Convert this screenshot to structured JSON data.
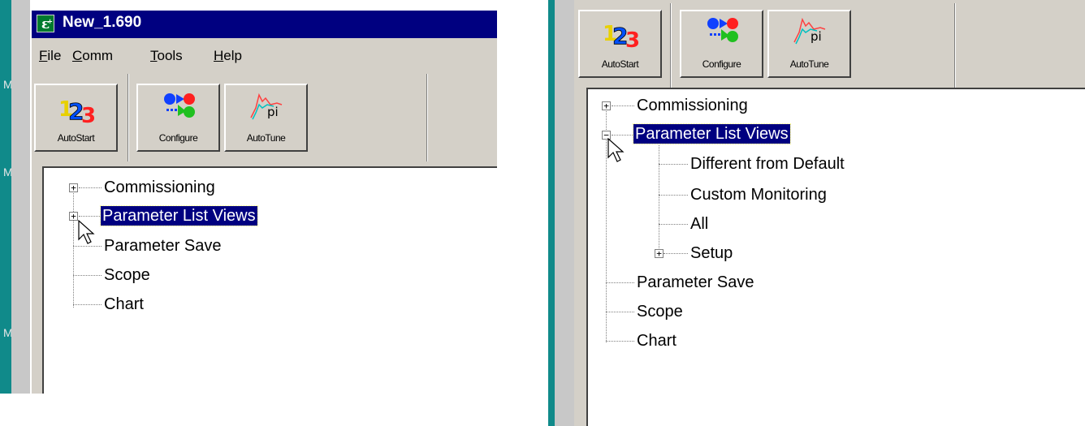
{
  "window": {
    "title": "New_1.690",
    "icon_glyph": "ε",
    "icon_superscript": "+"
  },
  "side_letters": [
    "M",
    "M",
    "M"
  ],
  "menu": {
    "file": {
      "accel": "F",
      "rest": "ile"
    },
    "comm": {
      "accel": "C",
      "rest": "omm"
    },
    "tools": {
      "accel": "T",
      "rest": "ools"
    },
    "help": {
      "accel": "H",
      "rest": "elp"
    }
  },
  "toolbar": {
    "autostart_label": "AutoStart",
    "configure_label": "Configure",
    "autotune_label": "AutoTune",
    "autostart_icon": "autostart-123-icon",
    "configure_icon": "configure-blocks-icon",
    "autotune_icon": "autotune-pi-icon",
    "autotune_glyph": "pi",
    "autostart_digits": [
      "1",
      "2",
      "3"
    ]
  },
  "tree_collapsed": {
    "nodes": [
      "Commissioning",
      "Parameter List Views",
      "Parameter Save",
      "Scope",
      "Chart"
    ],
    "selected": "Parameter List Views"
  },
  "tree_expanded": {
    "nodes": [
      "Commissioning",
      "Parameter List Views",
      "Parameter Save",
      "Scope",
      "Chart"
    ],
    "children": [
      "Different from Default",
      "Custom Monitoring",
      "All",
      "Setup"
    ],
    "selected": "Parameter List Views"
  },
  "expander_plus": "+",
  "expander_minus": "−",
  "colors": {
    "teal": "#108a8a",
    "titlebar": "#000080",
    "face": "#d4d0c8",
    "selection": "#000080"
  }
}
